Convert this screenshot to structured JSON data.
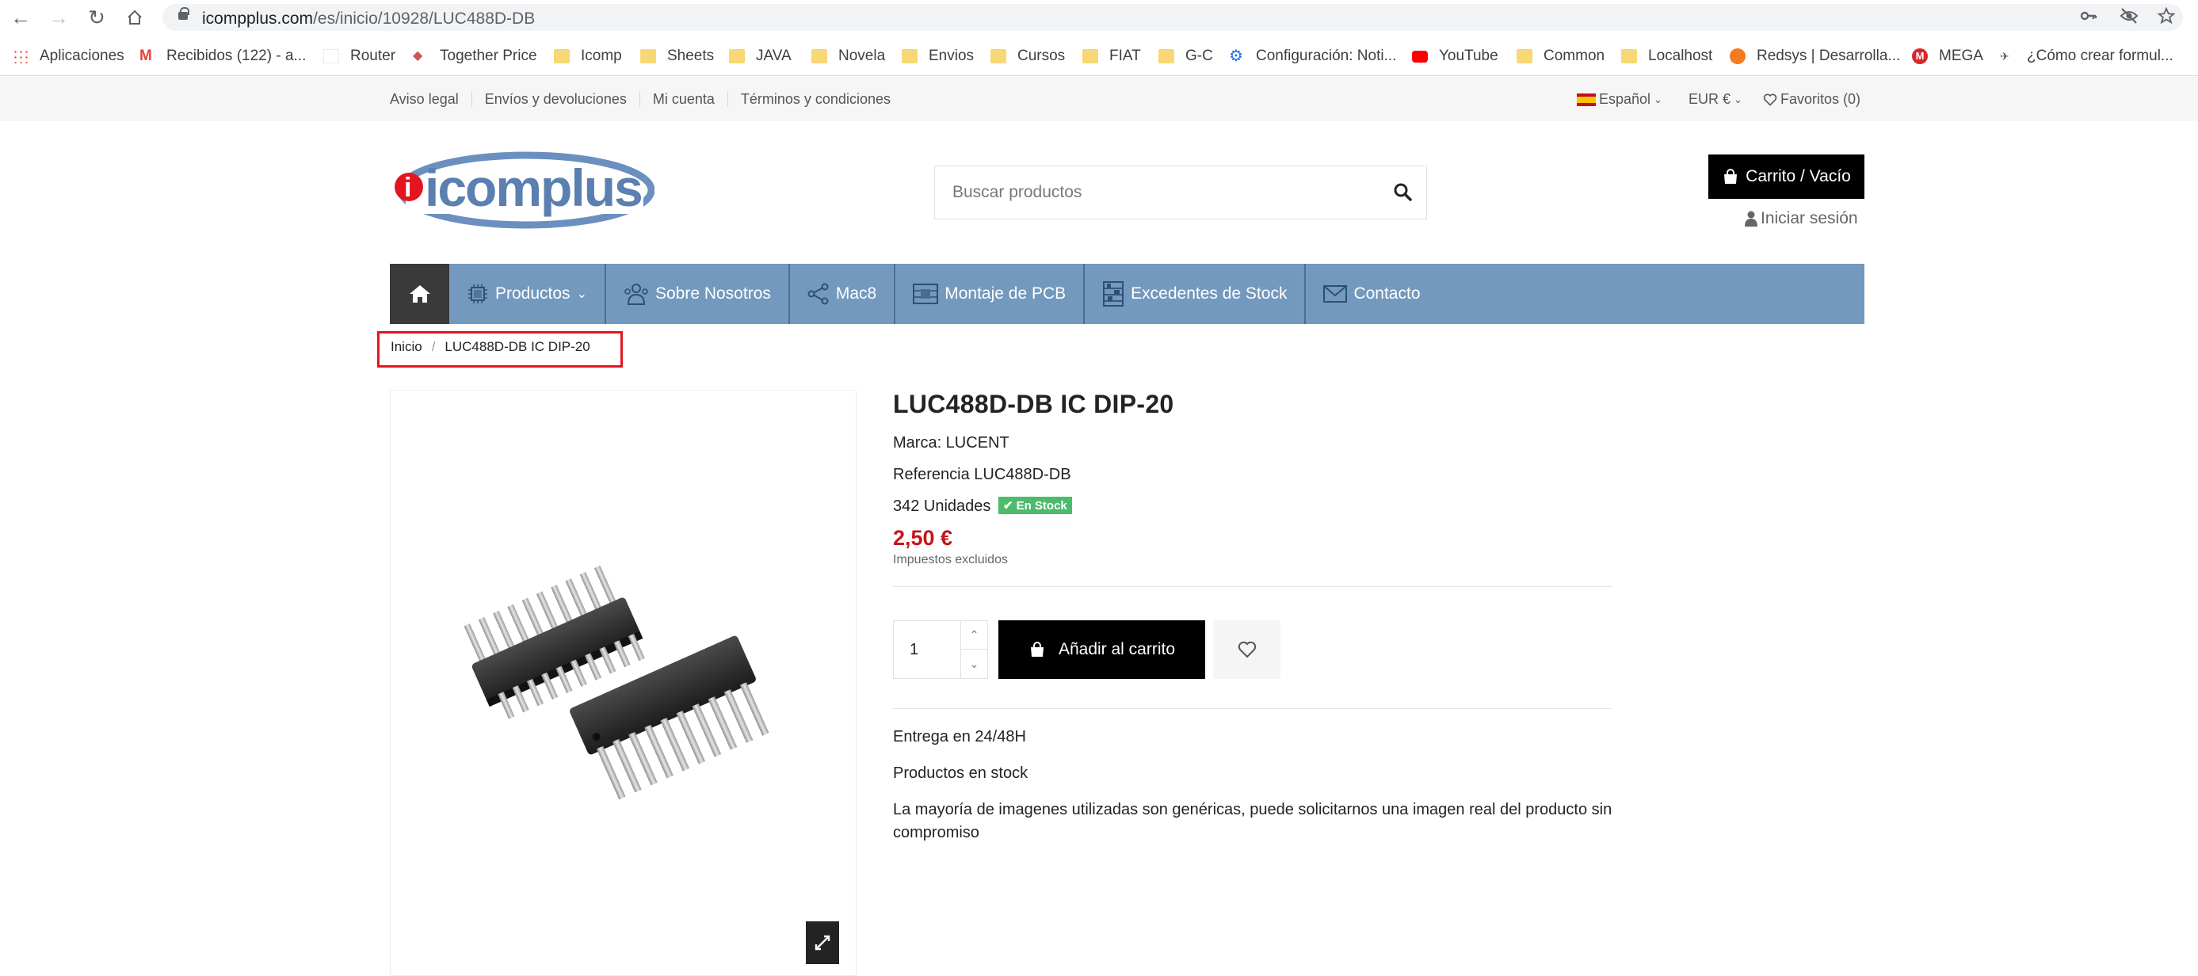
{
  "browser": {
    "url_host": "icompplus.com",
    "url_path": "/es/inicio/10928/LUC488D-DB",
    "bookmarks": [
      "Aplicaciones",
      "Recibidos (122) - a...",
      "Router",
      "Together Price",
      "Icomp",
      "Sheets",
      "JAVA",
      "Novela",
      "Envios",
      "Cursos",
      "FIAT",
      "G-C",
      "Configuración: Noti...",
      "YouTube",
      "Common",
      "Localhost",
      "Redsys | Desarrolla...",
      "MEGA",
      "¿Cómo crear formul..."
    ]
  },
  "topbar": {
    "links": [
      "Aviso legal",
      "Envíos y devoluciones",
      "Mi cuenta",
      "Términos y condiciones"
    ],
    "language": "Español",
    "currency": "EUR €",
    "favorites": "Favoritos (0)"
  },
  "header": {
    "logo_text": "icomplus",
    "search_placeholder": "Buscar productos",
    "cart_label": "Carrito / Vacío",
    "login_label": "Iniciar sesión"
  },
  "nav": {
    "items": [
      "Productos",
      "Sobre Nosotros",
      "Mac8",
      "Montaje de PCB",
      "Excedentes de Stock",
      "Contacto"
    ]
  },
  "breadcrumb": {
    "items": [
      "Inicio",
      "LUC488D-DB IC DIP-20"
    ]
  },
  "product": {
    "title": "LUC488D-DB IC DIP-20",
    "brand": "Marca: LUCENT",
    "reference": "Referencia LUC488D-DB",
    "units": "342 Unidades",
    "stock_badge": "En Stock",
    "price": "2,50 €",
    "tax_note": "Impuestos excluidos",
    "quantity": "1",
    "add_to_cart": "Añadir al carrito",
    "delivery": "Entrega en 24/48H",
    "in_stock_text": "Productos en stock",
    "disclaimer": "La mayoría de imagenes utilizadas son genéricas, puede solicitarnos una imagen real del producto sin compromiso"
  },
  "colors": {
    "nav_bg": "#7399be",
    "price": "#c5151c",
    "stock_badge": "#4cbb6c",
    "highlight_box": "#e3161f"
  }
}
